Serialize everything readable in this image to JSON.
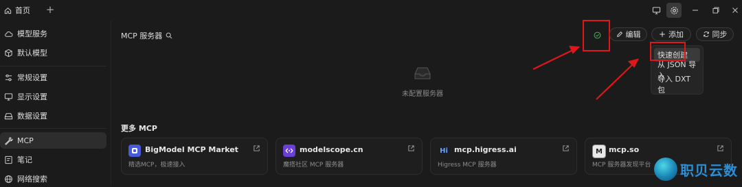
{
  "titlebar": {
    "home_tab": "首页",
    "add_tab": "+"
  },
  "sidebar": {
    "items": [
      {
        "label": "模型服务",
        "icon": "cloud-icon"
      },
      {
        "label": "默认模型",
        "icon": "cube-icon"
      },
      {
        "label": "常规设置",
        "icon": "sliders-icon"
      },
      {
        "label": "显示设置",
        "icon": "monitor-icon"
      },
      {
        "label": "数据设置",
        "icon": "storage-icon"
      },
      {
        "label": "MCP",
        "icon": "wrench-icon",
        "active": true
      },
      {
        "label": "笔记",
        "icon": "note-icon"
      },
      {
        "label": "网络搜索",
        "icon": "globe-icon"
      }
    ]
  },
  "main": {
    "title": "MCP 服务器",
    "buttons": {
      "edit": "编辑",
      "add": "添加",
      "sync": "同步"
    },
    "dropdown": [
      "快速创建",
      "从 JSON 导入",
      "导入 DXT 包"
    ],
    "empty_text": "未配置服务器",
    "more_title": "更多 MCP",
    "cards": [
      {
        "name": "BigModel MCP Market",
        "desc": "精选MCP，极速接入",
        "logo": "bigmodel-logo"
      },
      {
        "name": "modelscope.cn",
        "desc": "魔搭社区 MCP 服务器",
        "logo": "modelscope-logo"
      },
      {
        "name": "mcp.higress.ai",
        "desc": "Higress MCP 服务器",
        "logo": "Hi"
      },
      {
        "name": "mcp.so",
        "desc": "MCP 服务器发现平台",
        "logo": "M"
      }
    ]
  },
  "watermark": {
    "text": "职贝云数"
  },
  "colors": {
    "annotation_red": "#e1161a",
    "status_green": "#3fb950",
    "background": "#1b1b1b"
  }
}
